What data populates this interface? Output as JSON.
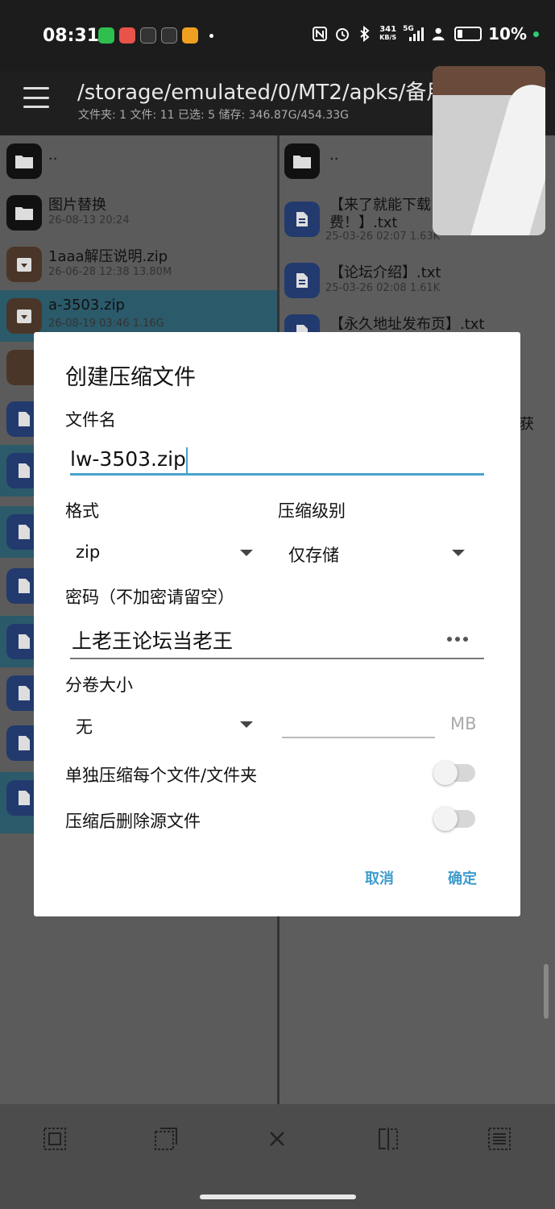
{
  "status_bar": {
    "time": "08:31",
    "net_speed_top": "341",
    "net_speed_unit": "KB/S",
    "signal_label": "5G",
    "battery_pct": "10%"
  },
  "app_bar": {
    "path": "/storage/emulated/0/MT2/apks/备用",
    "info": "文件夹: 1  文件: 11  已选: 5  储存: 346.87G/454.33G"
  },
  "left_pane": [
    {
      "name": "..",
      "meta": ""
    },
    {
      "name": "图片替换",
      "meta": "26-08-13 20:24"
    },
    {
      "name": "1aaa解压说明.zip",
      "meta": "26-06-28 12:38  13.80M"
    },
    {
      "name": "a-3503.zip",
      "meta": "26-08-19 03:46  1.16G"
    }
  ],
  "right_pane": [
    {
      "name": "..",
      "meta": ""
    },
    {
      "name": "【来了就能下载",
      "name2": "费！】.txt",
      "meta": "25-03-26 02:07  1.63K"
    },
    {
      "name": "【论坛介绍】.txt",
      "meta": "25-03-26 02:08  1.61K"
    },
    {
      "name": "【永久地址发布页】.txt",
      "meta": ""
    }
  ],
  "right_extra_text": "获",
  "dialog": {
    "title": "创建压缩文件",
    "filename_label": "文件名",
    "filename_value": "lw-3503.zip",
    "format_label": "格式",
    "format_value": "zip",
    "level_label": "压缩级别",
    "level_value": "仅存储",
    "password_label": "密码（不加密请留空）",
    "password_value": "上老王论坛当老王",
    "split_label": "分卷大小",
    "split_value": "无",
    "split_unit": "MB",
    "option_each": "单独压缩每个文件/文件夹",
    "option_delete": "压缩后删除源文件",
    "cancel": "取消",
    "ok": "确定"
  }
}
